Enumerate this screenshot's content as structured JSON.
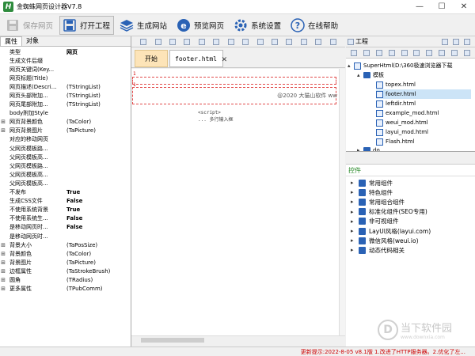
{
  "window": {
    "title": "金蜘蛛网页设计器V7.8",
    "app_icon": "H"
  },
  "toolbar": {
    "buttons": [
      {
        "label": "保存网页",
        "icon": "save-icon",
        "enabled": false
      },
      {
        "label": "打开工程",
        "icon": "open-project-icon",
        "enabled": true
      },
      {
        "label": "生成网站",
        "icon": "generate-site-icon",
        "enabled": true
      },
      {
        "label": "预览网页",
        "icon": "preview-icon",
        "enabled": true
      },
      {
        "label": "系统设置",
        "icon": "gear-icon",
        "enabled": true
      },
      {
        "label": "在线帮助",
        "icon": "help-icon",
        "enabled": true
      }
    ]
  },
  "left_panel": {
    "tabs": [
      "属性",
      "对象"
    ],
    "properties": [
      {
        "name": "类型",
        "value": "网页",
        "bold": true,
        "expand": ""
      },
      {
        "name": "生成文件后缀",
        "value": "",
        "bold": false,
        "expand": ""
      },
      {
        "name": "网页关键词(Key...",
        "value": "",
        "bold": false,
        "expand": ""
      },
      {
        "name": "网页标题(Title)",
        "value": "",
        "bold": false,
        "expand": ""
      },
      {
        "name": "网页描述(Descri...",
        "value": "(TStringList)",
        "bold": false,
        "expand": ""
      },
      {
        "name": "网页头部附加...",
        "value": "(TStringList)",
        "bold": false,
        "expand": ""
      },
      {
        "name": "网页尾部附加...",
        "value": "(TStringList)",
        "bold": false,
        "expand": ""
      },
      {
        "name": "body附加Style",
        "value": "",
        "bold": false,
        "expand": ""
      },
      {
        "name": "网页背景颜色",
        "value": "(TaColor)",
        "bold": false,
        "expand": "⊞"
      },
      {
        "name": "网页背景图片",
        "value": "(TaPicture)",
        "bold": false,
        "expand": "⊞"
      },
      {
        "name": "对应的移动网页",
        "value": "",
        "bold": false,
        "expand": ""
      },
      {
        "name": "父网页模板路...",
        "value": "",
        "bold": false,
        "expand": ""
      },
      {
        "name": "父网页模板高...",
        "value": "",
        "bold": false,
        "expand": ""
      },
      {
        "name": "父网页模板路...",
        "value": "",
        "bold": false,
        "expand": ""
      },
      {
        "name": "父网页模板高...",
        "value": "",
        "bold": false,
        "expand": ""
      },
      {
        "name": "父网页模板高...",
        "value": "",
        "bold": false,
        "expand": ""
      },
      {
        "name": "不发布",
        "value": "True",
        "bold": true,
        "expand": ""
      },
      {
        "name": "生成CSS文件",
        "value": "False",
        "bold": true,
        "expand": ""
      },
      {
        "name": "不使用系统背景",
        "value": "True",
        "bold": true,
        "expand": ""
      },
      {
        "name": "不使用系统生...",
        "value": "False",
        "bold": true,
        "expand": ""
      },
      {
        "name": "是移动网页时...",
        "value": "False",
        "bold": true,
        "expand": ""
      },
      {
        "name": "是移动网页时...",
        "value": "",
        "bold": false,
        "expand": ""
      },
      {
        "name": "背景大小",
        "value": "(TaPosSize)",
        "bold": false,
        "expand": "⊞"
      },
      {
        "name": "背景颜色",
        "value": "(TaColor)",
        "bold": false,
        "expand": "⊞"
      },
      {
        "name": "背景图片",
        "value": "(TaPicture)",
        "bold": false,
        "expand": "⊞"
      },
      {
        "name": "边框属性",
        "value": "(TaStrokeBrush)",
        "bold": false,
        "expand": "⊞"
      },
      {
        "name": "圆角",
        "value": "(TRadius)",
        "bold": false,
        "expand": "⊞"
      },
      {
        "name": "更多属性",
        "value": "(TPubComm)",
        "bold": false,
        "expand": "⊞"
      }
    ]
  },
  "editor": {
    "tabs": [
      {
        "label": "开始"
      },
      {
        "label": "footer.html",
        "close": "✕"
      }
    ],
    "line_marks": [
      "1",
      "1"
    ],
    "copyright": "@2020 大猫山软件 ww",
    "code_lines": [
      "<script>",
      "  ...  多行输入框"
    ]
  },
  "right_panel": {
    "header_title": "工程",
    "tree": {
      "root": "SuperHtml(D:\\360极速浏览器下载",
      "folder": "模板",
      "files": [
        "topex.html",
        "footer.html",
        "leftdir.html",
        "example_mod.html",
        "weui_mod.html",
        "layui_mod.html",
        "Flash.html"
      ],
      "selected_index": 1,
      "collapsed_root": "do"
    },
    "components_tab": "控件",
    "components": [
      "常用组件",
      "特色组件",
      "常用组合组件",
      "标准化组件(SEO专用)",
      "非可视组件",
      "LayUI风格(layui.com)",
      "微信风格(weui.io)",
      "动态代码相关"
    ]
  },
  "status": {
    "text": "更新提示:2022-8-05 v8.1版 1.改进了HTTP服务器。2.优化了左..."
  },
  "watermark": {
    "cn": "当下软件园",
    "en": "www.downxia.com"
  },
  "colors": {
    "accent_blue": "#2a62b5",
    "start_tab": "#fde4b8",
    "status_red": "#cc0000"
  }
}
